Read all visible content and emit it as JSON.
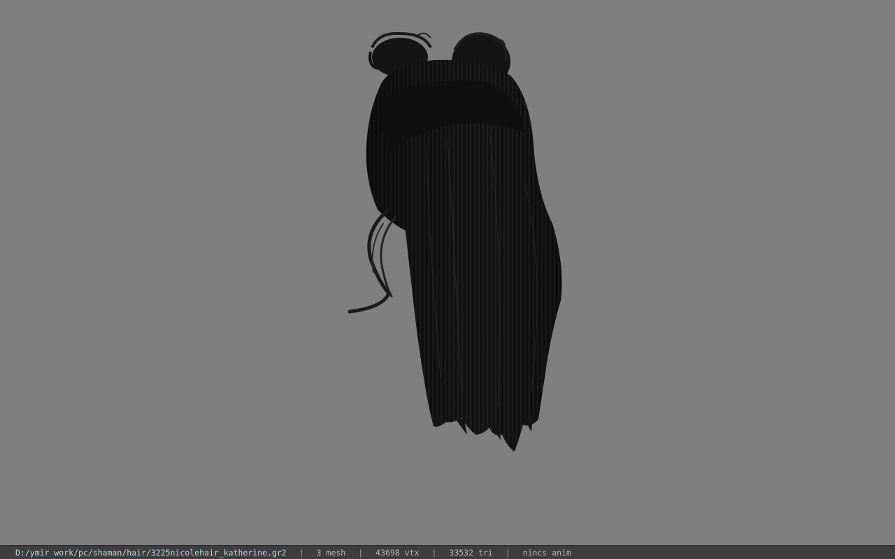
{
  "viewer": {
    "background_color": "#7f7f7f",
    "model": {
      "subject": "long dark hair with two top buns",
      "color": "#141414"
    }
  },
  "statusbar": {
    "file_path": "D:/ymir work/pc/shaman/hair/3225nicolehair_katherine.gr2",
    "separator": "|",
    "mesh_count": "3 mesh",
    "vertex_count": "43698 vtx",
    "triangle_count": "33532 tri",
    "anim_status": "nincs anim"
  }
}
